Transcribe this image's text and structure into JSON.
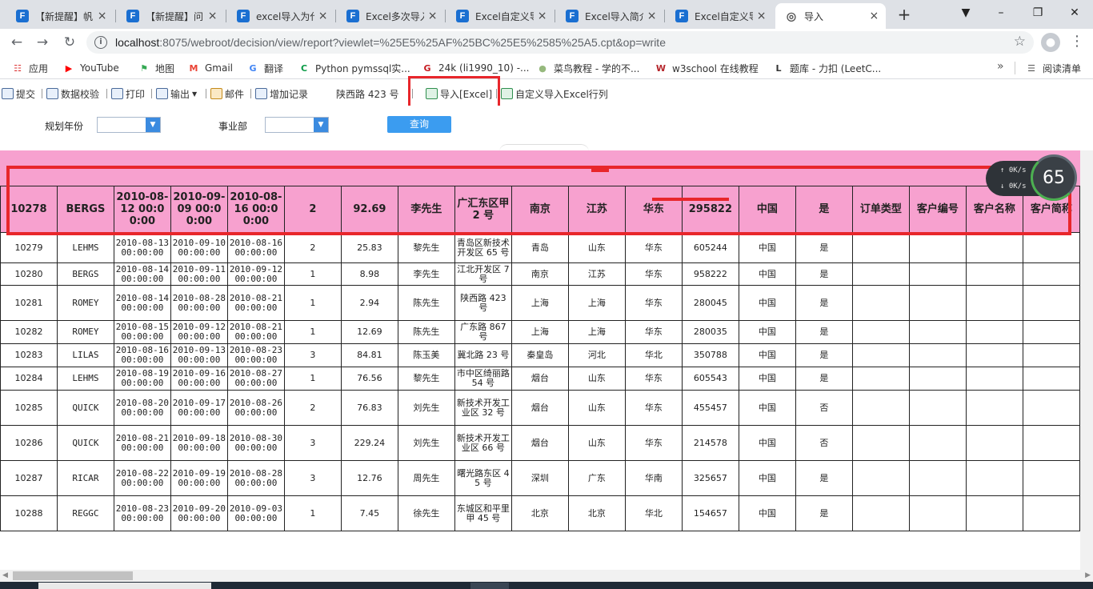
{
  "browser": {
    "tabs": [
      {
        "title": "【新提醒】帆",
        "icon": "F"
      },
      {
        "title": "【新提醒】问",
        "icon": "F"
      },
      {
        "title": "excel导入为代",
        "icon": "F"
      },
      {
        "title": "Excel多次导入",
        "icon": "F"
      },
      {
        "title": "Excel自定义导",
        "icon": "F"
      },
      {
        "title": "Excel导入简介",
        "icon": "F"
      },
      {
        "title": "Excel自定义导",
        "icon": "F"
      },
      {
        "title": "导入",
        "icon": "globe",
        "active": true
      }
    ],
    "url_host": "localhost",
    "url_rest": ":8075/webroot/decision/view/report?viewlet=%25E5%25AF%25BC%25E5%2585%25A5.cpt&op=write",
    "bookmarks": [
      {
        "label": "应用",
        "icon": "apps-icon"
      },
      {
        "label": "YouTube",
        "icon": "youtube-icon",
        "color": "#ff0000"
      },
      {
        "label": "地图",
        "icon": "maps-icon",
        "color": "#34a853"
      },
      {
        "label": "Gmail",
        "icon": "gmail-icon",
        "color": "#ea4335"
      },
      {
        "label": "翻译",
        "icon": "translate-icon",
        "color": "#4285f4"
      },
      {
        "label": "Python pymssql实...",
        "icon": "csdn-icon",
        "color": "#0a9b46"
      },
      {
        "label": "24k (li1990_10) -...",
        "icon": "gitee-icon",
        "color": "#c71d23"
      },
      {
        "label": "菜鸟教程 - 学的不...",
        "icon": "runoob-icon",
        "color": "#96b97d"
      },
      {
        "label": "w3school 在线教程",
        "icon": "w3school-icon",
        "color": "#b5252b"
      },
      {
        "label": "题库 - 力扣 (LeetC...",
        "icon": "leetcode-icon",
        "color": "#333333"
      }
    ],
    "reading_list": "阅读清单"
  },
  "toolbar": {
    "submit": "提交",
    "validate": "数据校验",
    "print": "打印",
    "export": "输出",
    "mail": "邮件",
    "add_record": "增加记录",
    "cell_value": "陕西路 423 号",
    "import_excel": "导入[Excel]",
    "custom_import": "自定义导入Excel行列"
  },
  "params": {
    "year_label": "规划年份",
    "dept_label": "事业部",
    "query": "查询"
  },
  "speed_widget": {
    "up": "0K/s",
    "down": "0K/s",
    "value": "65"
  },
  "table": {
    "header": [
      "10278",
      "BERGS",
      "2010-08-12 00:00:00",
      "2010-09-09 00:00:00",
      "2010-08-16 00:00:00",
      "2",
      "92.69",
      "李先生",
      "广汇东区甲 2 号",
      "南京",
      "江苏",
      "华东",
      "295822",
      "中国",
      "是",
      "订单类型",
      "客户编号",
      "客户名称",
      "客户简称"
    ],
    "rows": [
      [
        "10279",
        "LEHMS",
        "2010-08-13 00:00:00",
        "2010-09-10 00:00:00",
        "2010-08-16 00:00:00",
        "2",
        "25.83",
        "黎先生",
        "青岛区新技术开发区 65 号",
        "青岛",
        "山东",
        "华东",
        "605244",
        "中国",
        "是",
        "",
        "",
        "",
        ""
      ],
      [
        "10280",
        "BERGS",
        "2010-08-14 00:00:00",
        "2010-09-11 00:00:00",
        "2010-09-12 00:00:00",
        "1",
        "8.98",
        "李先生",
        "江北开发区 7 号",
        "南京",
        "江苏",
        "华东",
        "958222",
        "中国",
        "是",
        "",
        "",
        "",
        ""
      ],
      [
        "10281",
        "ROMEY",
        "2010-08-14 00:00:00",
        "2010-08-28 00:00:00",
        "2010-08-21 00:00:00",
        "1",
        "2.94",
        "陈先生",
        "陕西路 423 号",
        "上海",
        "上海",
        "华东",
        "280045",
        "中国",
        "是",
        "",
        "",
        "",
        ""
      ],
      [
        "10282",
        "ROMEY",
        "2010-08-15 00:00:00",
        "2010-09-12 00:00:00",
        "2010-08-21 00:00:00",
        "1",
        "12.69",
        "陈先生",
        "广东路 867 号",
        "上海",
        "上海",
        "华东",
        "280035",
        "中国",
        "是",
        "",
        "",
        "",
        ""
      ],
      [
        "10283",
        "LILAS",
        "2010-08-16 00:00:00",
        "2010-09-13 00:00:00",
        "2010-08-23 00:00:00",
        "3",
        "84.81",
        "陈玉美",
        "冀北路 23 号",
        "秦皇岛",
        "河北",
        "华北",
        "350788",
        "中国",
        "是",
        "",
        "",
        "",
        ""
      ],
      [
        "10284",
        "LEHMS",
        "2010-08-19 00:00:00",
        "2010-09-16 00:00:00",
        "2010-08-27 00:00:00",
        "1",
        "76.56",
        "黎先生",
        "市中区绮丽路 54 号",
        "烟台",
        "山东",
        "华东",
        "605543",
        "中国",
        "是",
        "",
        "",
        "",
        ""
      ],
      [
        "10285",
        "QUICK",
        "2010-08-20 00:00:00",
        "2010-09-17 00:00:00",
        "2010-08-26 00:00:00",
        "2",
        "76.83",
        "刘先生",
        "新技术开发工业区 32 号",
        "烟台",
        "山东",
        "华东",
        "455457",
        "中国",
        "否",
        "",
        "",
        "",
        ""
      ],
      [
        "10286",
        "QUICK",
        "2010-08-21 00:00:00",
        "2010-09-18 00:00:00",
        "2010-08-30 00:00:00",
        "3",
        "229.24",
        "刘先生",
        "新技术开发工业区 66 号",
        "烟台",
        "山东",
        "华东",
        "214578",
        "中国",
        "否",
        "",
        "",
        "",
        ""
      ],
      [
        "10287",
        "RICAR",
        "2010-08-22 00:00:00",
        "2010-09-19 00:00:00",
        "2010-08-28 00:00:00",
        "3",
        "12.76",
        "周先生",
        "曙光路东区 45 号",
        "深圳",
        "广东",
        "华南",
        "325657",
        "中国",
        "是",
        "",
        "",
        "",
        ""
      ],
      [
        "10288",
        "REGGC",
        "2010-08-23 00:00:00",
        "2010-09-20 00:00:00",
        "2010-09-03 00:00:00",
        "1",
        "7.45",
        "徐先生",
        "东城区和平里甲 45 号",
        "北京",
        "北京",
        "华北",
        "154657",
        "中国",
        "是",
        "",
        "",
        "",
        ""
      ]
    ]
  },
  "accent_colors": {
    "header_pink": "#f7a1cf",
    "highlight_red": "#e8262b",
    "query_blue": "#3b9cf0"
  }
}
